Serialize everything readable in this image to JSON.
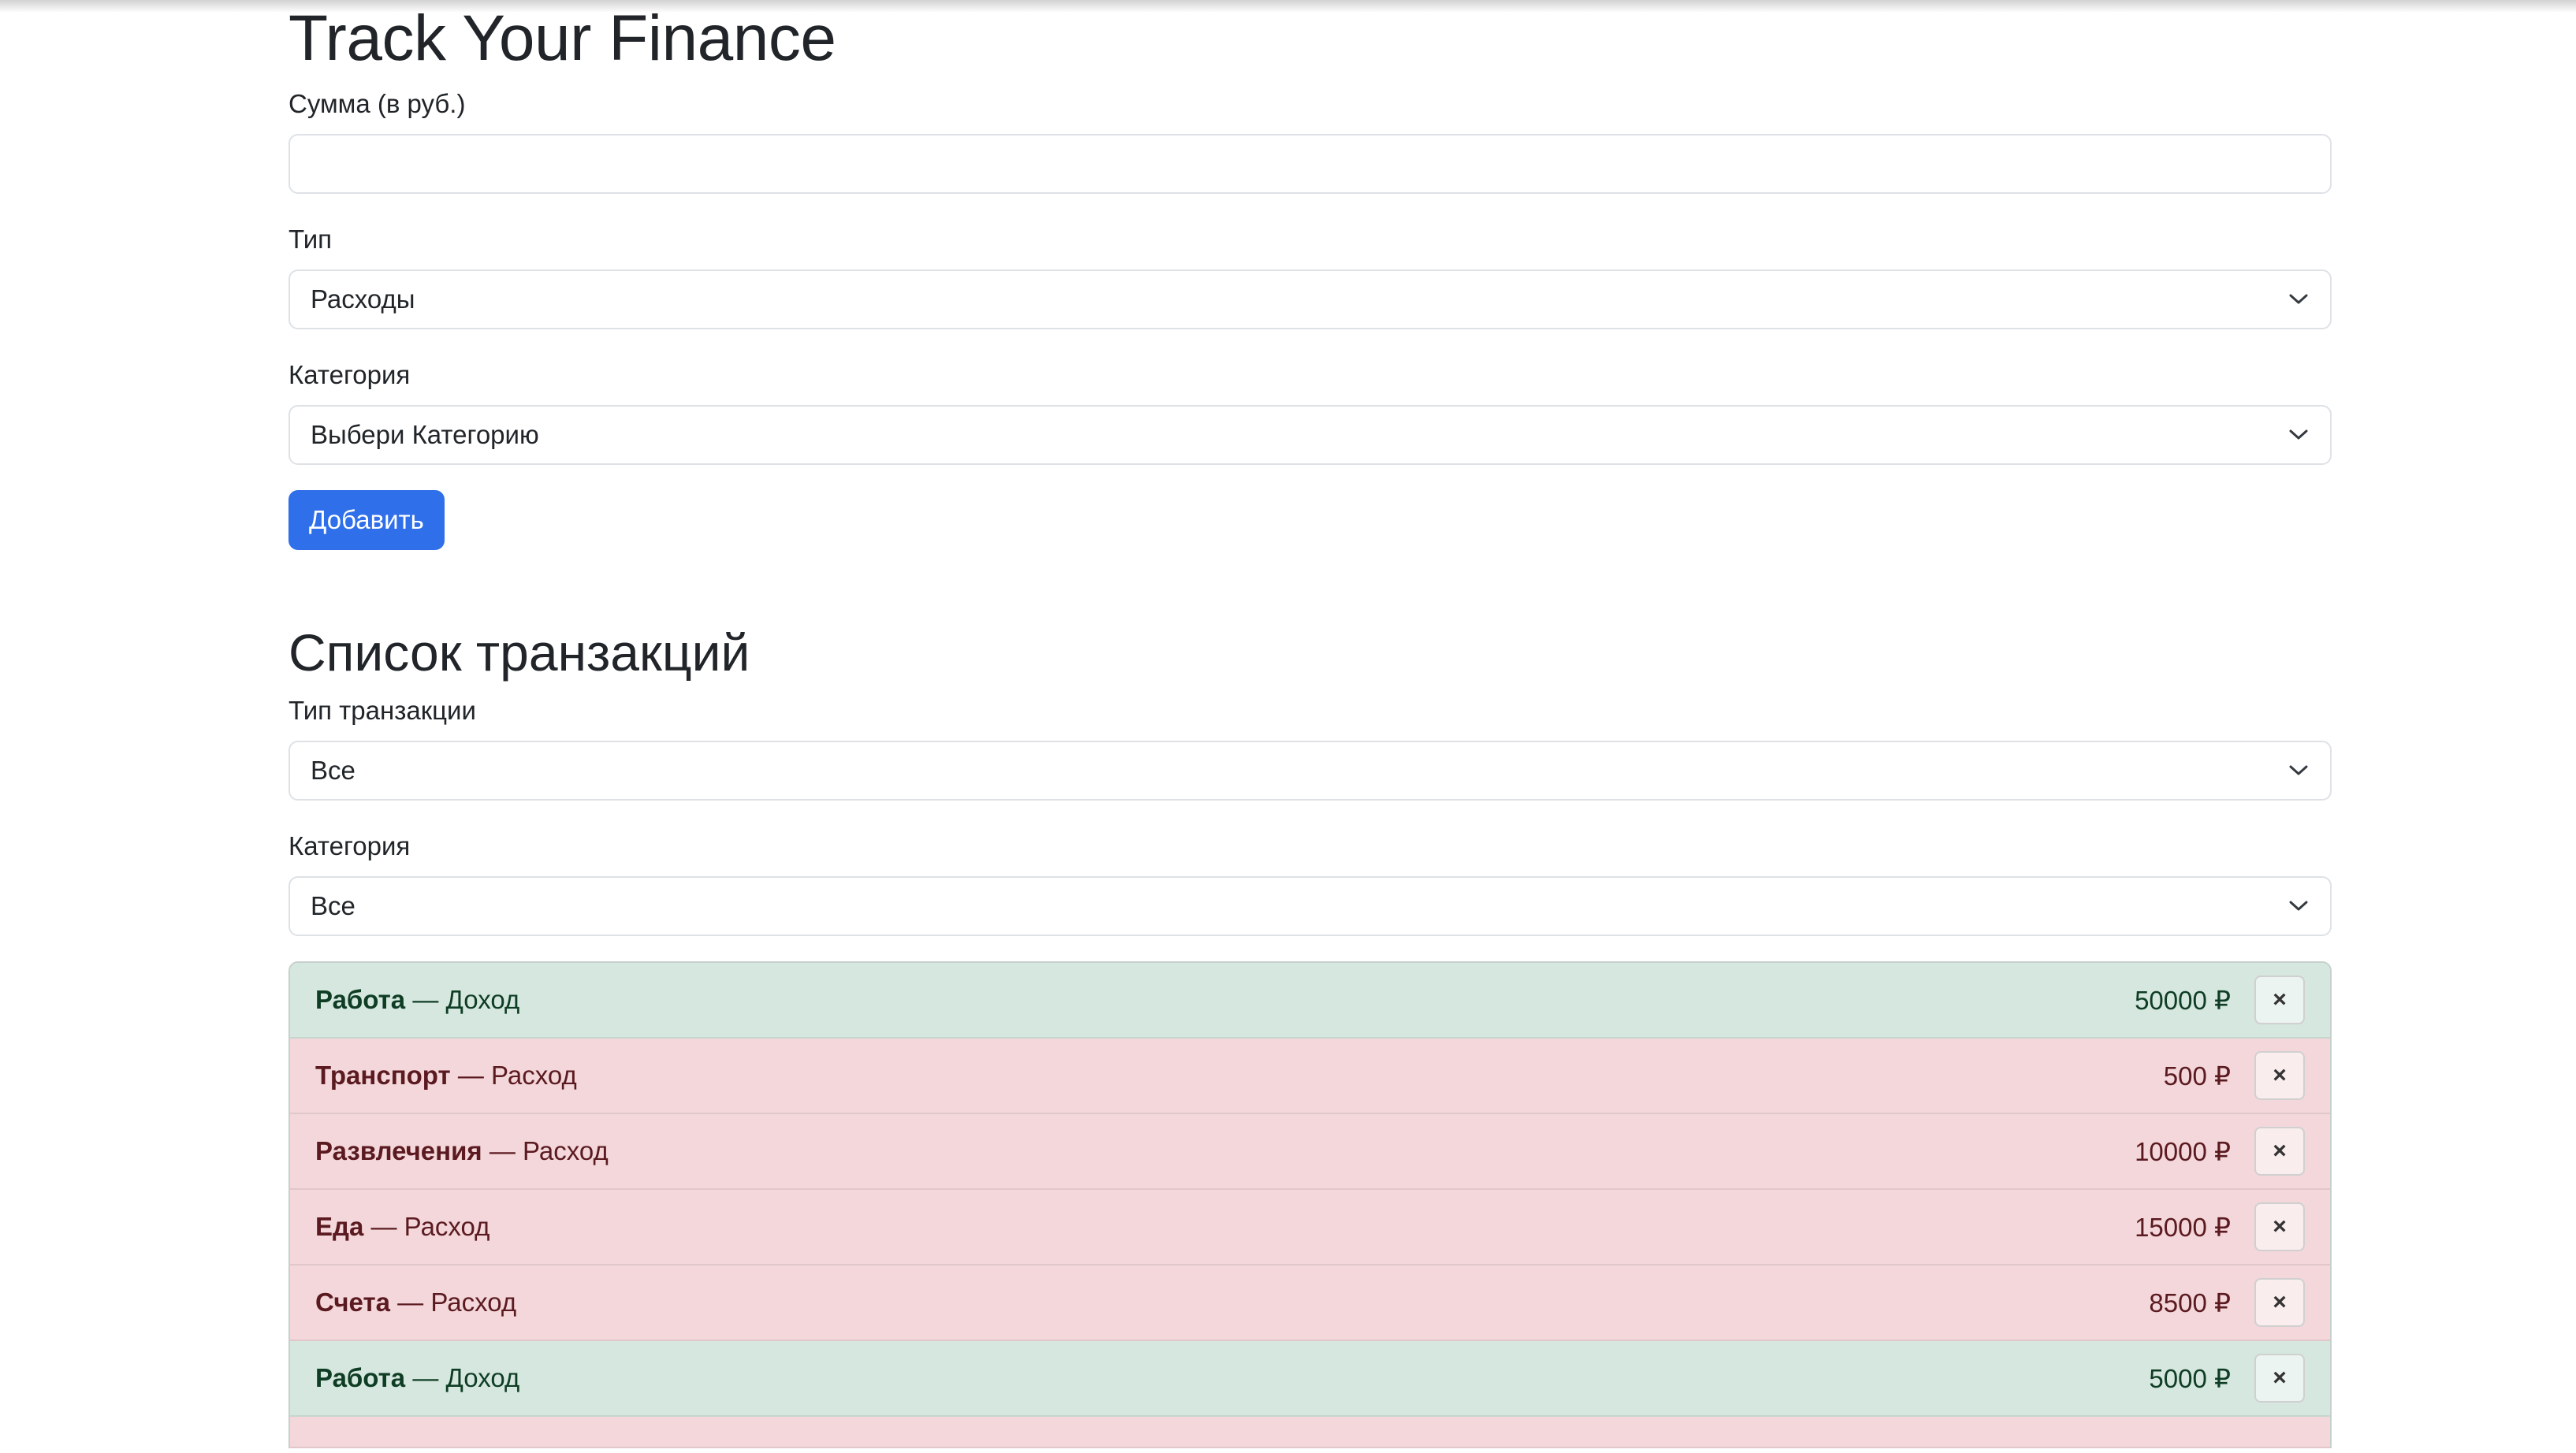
{
  "app_title": "Track Your Finance",
  "form": {
    "amount_label": "Сумма (в руб.)",
    "amount_value": "",
    "type_label": "Тип",
    "type_value": "Расходы",
    "category_label": "Категория",
    "category_value": "Выбери Категорию",
    "submit_label": "Добавить"
  },
  "transactions": {
    "title": "Список транзакций",
    "filter_type_label": "Тип транзакции",
    "filter_type_value": "Все",
    "filter_category_label": "Категория",
    "filter_category_value": "Все",
    "items": [
      {
        "category": "Работа",
        "type": "— Доход",
        "amount": "50000 ₽",
        "kind": "income",
        "delete": "×"
      },
      {
        "category": "Транспорт",
        "type": "— Расход",
        "amount": "500 ₽",
        "kind": "expense",
        "delete": "×"
      },
      {
        "category": "Развлечения",
        "type": "— Расход",
        "amount": "10000 ₽",
        "kind": "expense",
        "delete": "×"
      },
      {
        "category": "Еда",
        "type": "— Расход",
        "amount": "15000 ₽",
        "kind": "expense",
        "delete": "×"
      },
      {
        "category": "Счета",
        "type": "— Расход",
        "amount": "8500 ₽",
        "kind": "expense",
        "delete": "×"
      },
      {
        "category": "Работа",
        "type": "— Доход",
        "amount": "5000 ₽",
        "kind": "income",
        "delete": "×"
      }
    ]
  },
  "colors": {
    "primary": "#2f6fe9",
    "income_bg": "#d5e7df",
    "expense_bg": "#f3d7da"
  },
  "icons": {
    "select_arrow": "chevron-down-icon",
    "delete": "close-icon"
  }
}
